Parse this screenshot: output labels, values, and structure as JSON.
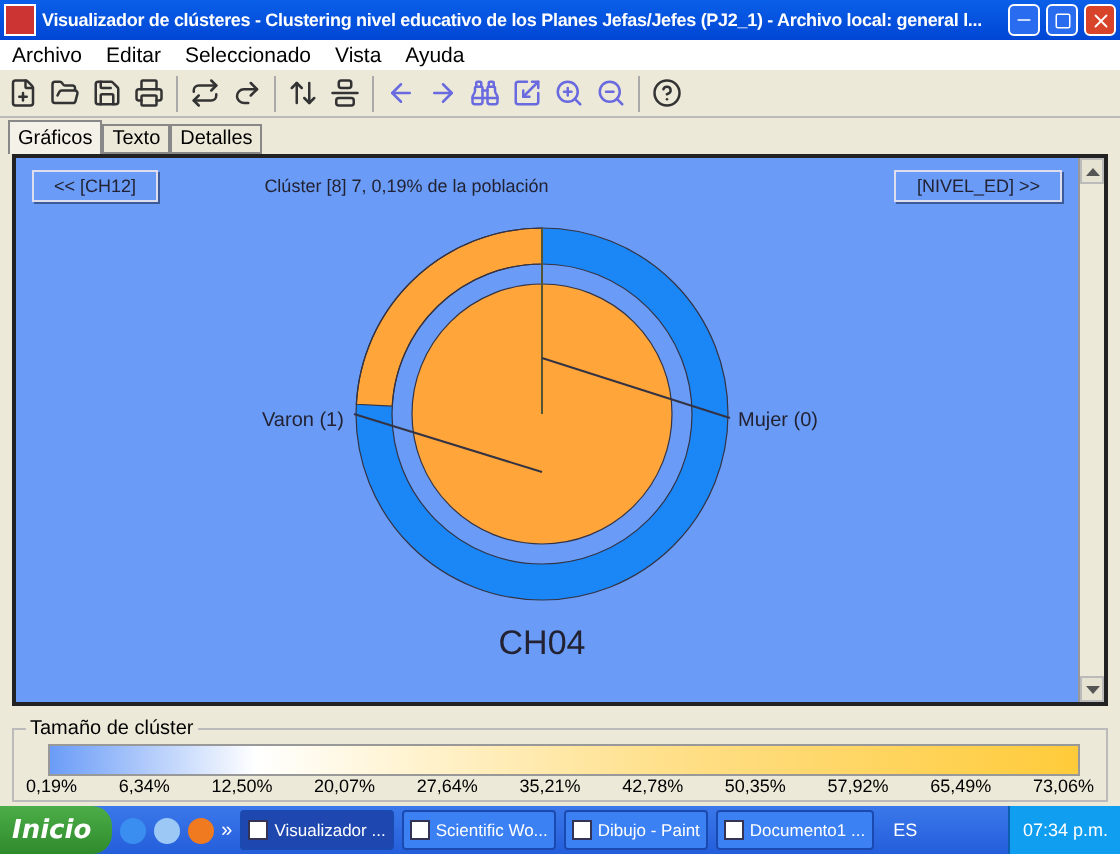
{
  "window": {
    "title": "Visualizador de clústeres - Clustering nivel educativo de los Planes Jefas/Jefes (PJ2_1) - Archivo local: general l..."
  },
  "menu": [
    "Archivo",
    "Editar",
    "Seleccionado",
    "Vista",
    "Ayuda"
  ],
  "tabs": [
    {
      "label": "Gráficos",
      "selected": true
    },
    {
      "label": "Texto",
      "selected": false
    },
    {
      "label": "Detalles",
      "selected": false
    }
  ],
  "panel": {
    "prev_button": "<< [CH12]",
    "caption": "Clúster [8] 7, 0,19% de la población",
    "next_button": "[NIVEL_ED] >>",
    "labels": [
      "Varon (1)",
      "Mujer (0)"
    ],
    "center_label": "CH04"
  },
  "legend": {
    "title": "Tamaño de clúster",
    "ticks": [
      "0,19%",
      "6,34%",
      "12,50%",
      "20,07%",
      "27,64%",
      "35,21%",
      "42,78%",
      "50,35%",
      "57,92%",
      "65,49%",
      "73,06%"
    ]
  },
  "taskbar": {
    "start": "Inicio",
    "more": "»",
    "tasks": [
      {
        "label": "Visualizador ...",
        "selected": true
      },
      {
        "label": "Scientific Wo...",
        "selected": false
      },
      {
        "label": "Dibujo - Paint",
        "selected": false
      },
      {
        "label": "Documento1 ...",
        "selected": false
      }
    ],
    "language": "ES",
    "clock": "07:34 p.m."
  }
}
